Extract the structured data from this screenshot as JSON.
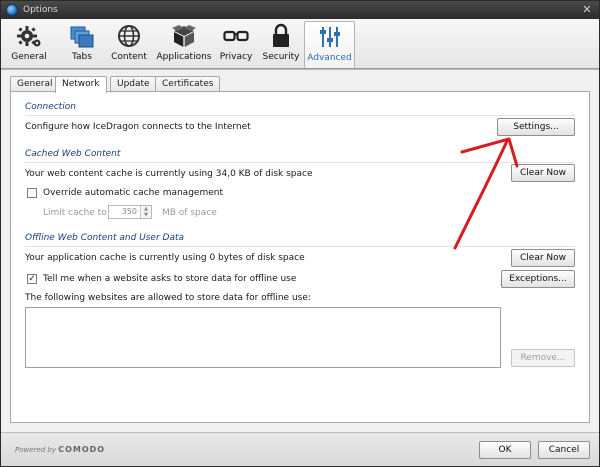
{
  "window": {
    "title": "Options"
  },
  "toolbar": {
    "items": [
      {
        "label": "General"
      },
      {
        "label": "Tabs"
      },
      {
        "label": "Content"
      },
      {
        "label": "Applications"
      },
      {
        "label": "Privacy"
      },
      {
        "label": "Security"
      },
      {
        "label": "Advanced"
      }
    ]
  },
  "subtabs": [
    {
      "label": "General"
    },
    {
      "label": "Network"
    },
    {
      "label": "Update"
    },
    {
      "label": "Certificates"
    }
  ],
  "connection": {
    "title": "Connection",
    "description": "Configure how IceDragon connects to the Internet",
    "settings_button": "Settings..."
  },
  "cache": {
    "title": "Cached Web Content",
    "usage_text": "Your web content cache is currently using 34,0 KB of disk space",
    "clear_button": "Clear Now",
    "override_label": "Override automatic cache management",
    "override_checked": false,
    "limit_label": "Limit cache to",
    "limit_value": "350",
    "limit_unit": "MB of space"
  },
  "offline": {
    "title": "Offline Web Content and User Data",
    "usage_text": "Your application cache is currently using 0 bytes of disk space",
    "clear_button": "Clear Now",
    "tell_me_label": "Tell me when a website asks to store data for offline use",
    "tell_me_checked": true,
    "exceptions_button": "Exceptions...",
    "allowed_label": "The following websites are allowed to store data for offline use:",
    "remove_button": "Remove..."
  },
  "footer": {
    "powered_by": "Powered by",
    "brand": "COMODO",
    "ok_button": "OK",
    "cancel_button": "Cancel"
  },
  "colors": {
    "annotation_arrow": "#d81c1c",
    "accent": "#2b6fb5"
  }
}
